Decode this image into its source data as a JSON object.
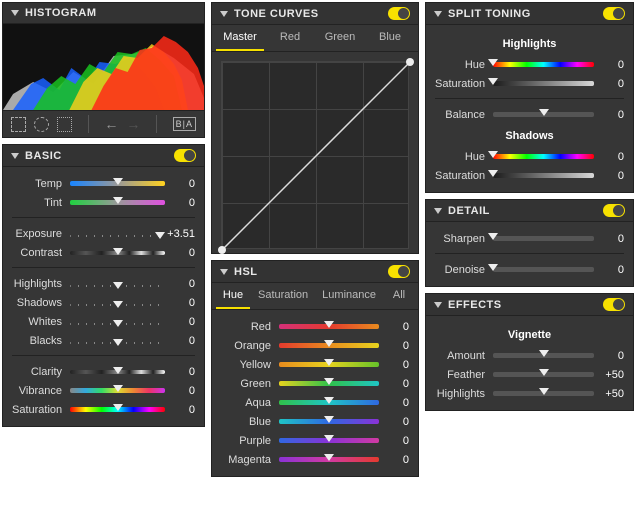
{
  "histogram": {
    "title": "HISTOGRAM",
    "ba_label": "B|A"
  },
  "basic": {
    "title": "BASIC",
    "temp": {
      "label": "Temp",
      "value": "0",
      "pos": 50
    },
    "tint": {
      "label": "Tint",
      "value": "0",
      "pos": 50
    },
    "exposure": {
      "label": "Exposure",
      "value": "+3.51",
      "pos": 95
    },
    "contrast": {
      "label": "Contrast",
      "value": "0",
      "pos": 50
    },
    "highlights": {
      "label": "Highlights",
      "value": "0",
      "pos": 50
    },
    "shadows": {
      "label": "Shadows",
      "value": "0",
      "pos": 50
    },
    "whites": {
      "label": "Whites",
      "value": "0",
      "pos": 50
    },
    "blacks": {
      "label": "Blacks",
      "value": "0",
      "pos": 50
    },
    "clarity": {
      "label": "Clarity",
      "value": "0",
      "pos": 50
    },
    "vibrance": {
      "label": "Vibrance",
      "value": "0",
      "pos": 50
    },
    "saturation": {
      "label": "Saturation",
      "value": "0",
      "pos": 50
    }
  },
  "tone_curves": {
    "title": "TONE CURVES",
    "tabs": {
      "master": "Master",
      "red": "Red",
      "green": "Green",
      "blue": "Blue"
    }
  },
  "hsl": {
    "title": "HSL",
    "tabs": {
      "hue": "Hue",
      "saturation": "Saturation",
      "luminance": "Luminance",
      "all": "All"
    },
    "rows": {
      "red": {
        "label": "Red",
        "value": "0",
        "pos": 50
      },
      "orange": {
        "label": "Orange",
        "value": "0",
        "pos": 50
      },
      "yellow": {
        "label": "Yellow",
        "value": "0",
        "pos": 50
      },
      "green": {
        "label": "Green",
        "value": "0",
        "pos": 50
      },
      "aqua": {
        "label": "Aqua",
        "value": "0",
        "pos": 50
      },
      "blue": {
        "label": "Blue",
        "value": "0",
        "pos": 50
      },
      "purple": {
        "label": "Purple",
        "value": "0",
        "pos": 50
      },
      "magenta": {
        "label": "Magenta",
        "value": "0",
        "pos": 50
      }
    }
  },
  "split_toning": {
    "title": "SPLIT TONING",
    "highlights_title": "Highlights",
    "shadows_title": "Shadows",
    "hl_hue": {
      "label": "Hue",
      "value": "0",
      "pos": 0
    },
    "hl_sat": {
      "label": "Saturation",
      "value": "0",
      "pos": 0
    },
    "balance": {
      "label": "Balance",
      "value": "0",
      "pos": 50
    },
    "sh_hue": {
      "label": "Hue",
      "value": "0",
      "pos": 0
    },
    "sh_sat": {
      "label": "Saturation",
      "value": "0",
      "pos": 0
    }
  },
  "detail": {
    "title": "DETAIL",
    "sharpen": {
      "label": "Sharpen",
      "value": "0",
      "pos": 0
    },
    "denoise": {
      "label": "Denoise",
      "value": "0",
      "pos": 0
    }
  },
  "effects": {
    "title": "EFFECTS",
    "vignette_title": "Vignette",
    "amount": {
      "label": "Amount",
      "value": "0",
      "pos": 50
    },
    "feather": {
      "label": "Feather",
      "value": "+50",
      "pos": 50
    },
    "highlights": {
      "label": "Highlights",
      "value": "+50",
      "pos": 50
    }
  }
}
